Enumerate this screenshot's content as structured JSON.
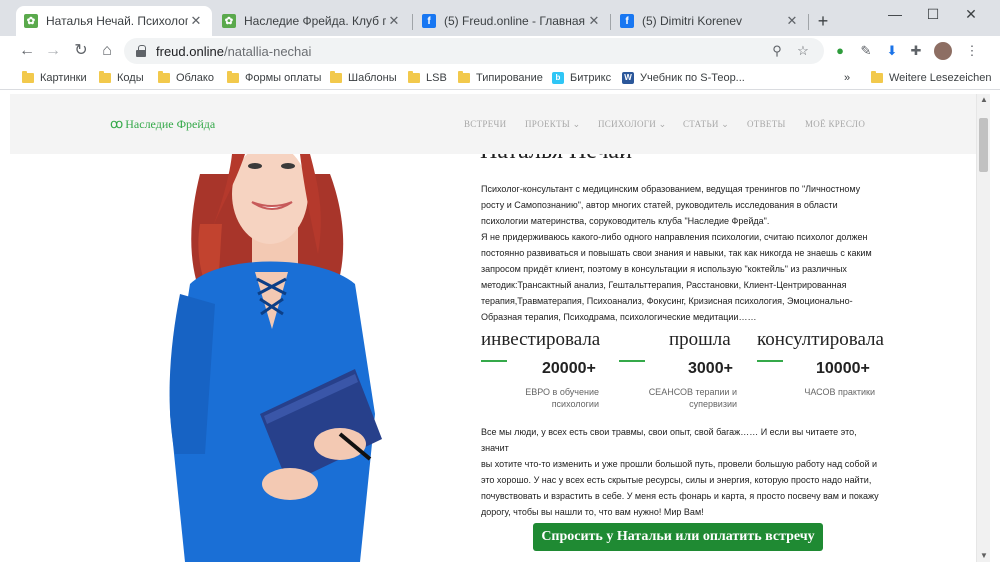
{
  "tabs": [
    {
      "title": "Наталья Нечай. Психолог-конс",
      "icon": "green-leaf-icon"
    },
    {
      "title": "Наследие Фрейда. Клуб психол",
      "icon": "green-leaf-icon"
    },
    {
      "title": "(5) Freud.online - Главная",
      "icon": "facebook-icon"
    },
    {
      "title": "(5) Dimitri Korenev",
      "icon": "facebook-icon"
    }
  ],
  "address": {
    "host": "freud.online",
    "path": "/natallia-nechai"
  },
  "bookmarks": [
    "Картинки",
    "Коды",
    "Облако",
    "Формы оплаты",
    "Шаблоны",
    "LSB",
    "Типирование",
    "Битрикс",
    "Учебник по S-Теор..."
  ],
  "bookmarks_more": "»",
  "bookmarks_other": "Weitere Lesezeichen",
  "site": {
    "logo": "Наследие Фрейда",
    "nav": [
      "ВСТРЕЧИ",
      "ПРОЕКТЫ",
      "ПСИХОЛОГИ",
      "СТАТЬИ",
      "ОТВЕТЫ",
      "МОЁ КРЕСЛО"
    ],
    "heading": "Наталья Нечай",
    "intro_lines": [
      "Психолог-консультант с медицинским образованием, ведущая тренингов по \"Личностному",
      "росту и Самопознанию\", автор многих статей, руководитель исследования в области",
      "психологии материнства, соруководитель клуба \"Наследие Фрейда\".",
      "Я не придерживаюсь какого-либо одного направления психологии, считаю психолог должен",
      "постоянно развиваться и повышать свои знания и навыки, так как никогда не знаешь с каким",
      "запросом придёт клиент, поэтому в консультации я использую \"коктейль\" из различных",
      "методик:Трансактный анализ, Гештальттерапия, Расстановки, Клиент-Центрированная",
      "терапия,Травматерапия, Психоанализ, Фокусинг, Кризисная психология, Эмоционально-",
      "Образная терапия, Психодрама, психологические медитации……"
    ],
    "stats": [
      {
        "word": "инвестировала",
        "number": "20000+",
        "caption_lines": [
          "ЕВРО в обучение",
          "психологии"
        ]
      },
      {
        "word": "прошла",
        "number": "3000+",
        "caption_lines": [
          "СЕАНСОВ терапии и",
          "супервизии"
        ]
      },
      {
        "word": "консултировала",
        "number": "10000+",
        "caption_lines": [
          "ЧАСОВ практики"
        ]
      }
    ],
    "outro_lines": [
      "Все мы люди, у всех есть свои травмы, свои опыт, свой багаж…… И если вы читаете это, значит",
      "вы хотите что-то изменить и уже прошли большой путь, провели большую работу над собой и",
      "это хорошо. У нас у всех есть скрытые ресурсы, силы и энергия, которую просто надо найти,",
      "почувствовать и взрастить в себе. У меня есть фонарь и карта, я просто посвечу вам и покажу",
      "дорогу, чтобы вы нашли то, что вам нужно! Мир Вам!"
    ],
    "cta": "Спросить у Натальи или оплатить встречу"
  },
  "colors": {
    "brand_green": "#35a94a",
    "cta_green": "#1f8a33",
    "dress_blue": "#1a6fd6"
  }
}
